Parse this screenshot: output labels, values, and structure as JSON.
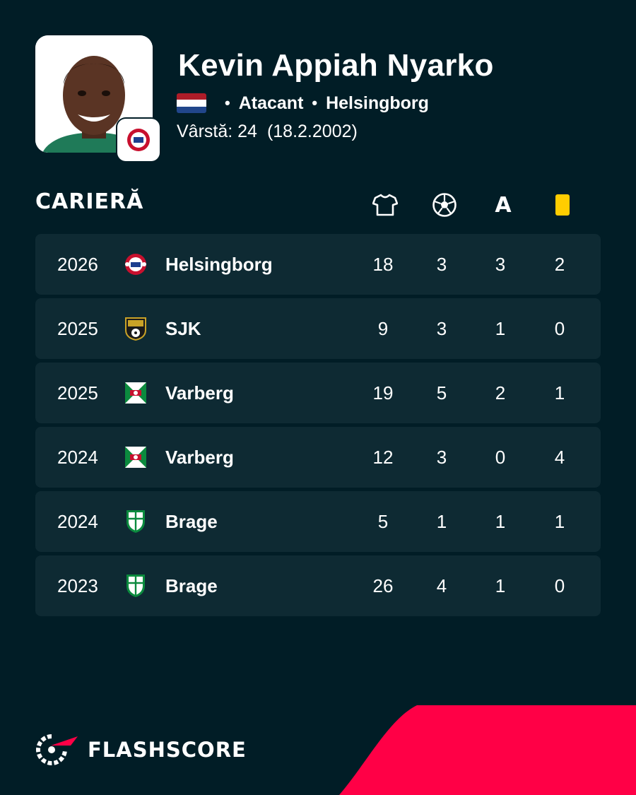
{
  "player": {
    "name": "Kevin Appiah Nyarko",
    "position": "Atacant",
    "club": "Helsingborg",
    "age_label": "Vârstă: 24",
    "birth_date": "(18.2.2002)",
    "flag": "netherlands-flag",
    "flag_colors": [
      "#ae1c28",
      "#ffffff",
      "#21468b"
    ]
  },
  "career": {
    "title": "CARIERĂ",
    "columns": [
      "jersey-icon",
      "ball-icon",
      "A",
      "yellow-card-icon"
    ],
    "rows": [
      {
        "year": "2026",
        "club": "Helsingborg",
        "crest": "helsingborg",
        "apps": "18",
        "goals": "3",
        "assists": "3",
        "yellow": "2"
      },
      {
        "year": "2025",
        "club": "SJK",
        "crest": "sjk",
        "apps": "9",
        "goals": "3",
        "assists": "1",
        "yellow": "0"
      },
      {
        "year": "2025",
        "club": "Varberg",
        "crest": "varberg",
        "apps": "19",
        "goals": "5",
        "assists": "2",
        "yellow": "1"
      },
      {
        "year": "2024",
        "club": "Varberg",
        "crest": "varberg",
        "apps": "12",
        "goals": "3",
        "assists": "0",
        "yellow": "4"
      },
      {
        "year": "2024",
        "club": "Brage",
        "crest": "brage",
        "apps": "5",
        "goals": "1",
        "assists": "1",
        "yellow": "1"
      },
      {
        "year": "2023",
        "club": "Brage",
        "crest": "brage",
        "apps": "26",
        "goals": "4",
        "assists": "1",
        "yellow": "0"
      }
    ]
  },
  "brand": {
    "name": "FLASHSCORE",
    "accent": "#ff0046",
    "background": "#011d26",
    "row_background": "#0e2a33",
    "card_yellow": "#ffcd00"
  }
}
